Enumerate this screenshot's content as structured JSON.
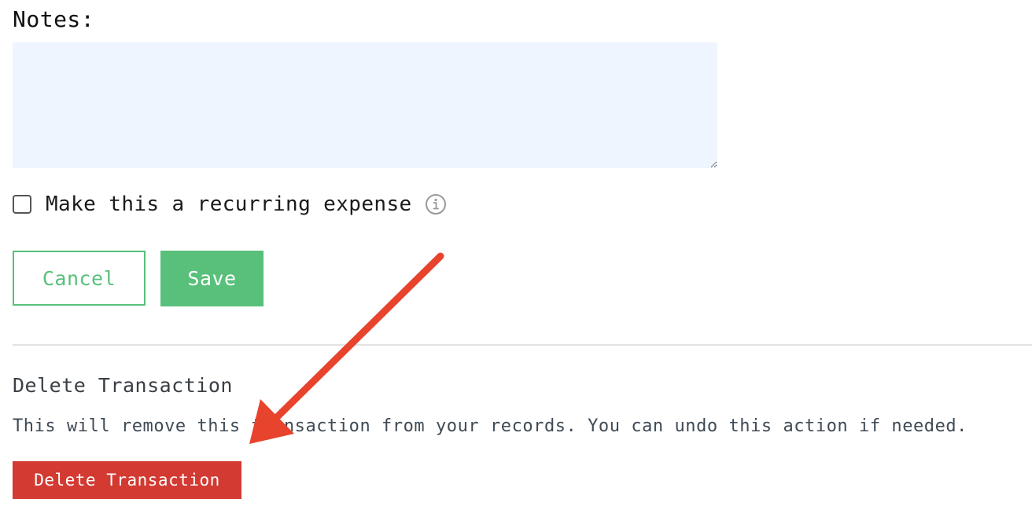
{
  "form": {
    "notes_label": "Notes:",
    "notes_value": "",
    "recurring_label": "Make this a recurring expense",
    "recurring_checked": false,
    "info_icon": "info-icon",
    "cancel_label": "Cancel",
    "save_label": "Save"
  },
  "delete_section": {
    "heading": "Delete Transaction",
    "description": "This will remove this transaction from your records. You can undo this action if needed.",
    "button_label": "Delete Transaction"
  },
  "annotation": {
    "type": "arrow",
    "color": "#e8432d"
  },
  "colors": {
    "accent_green": "#58c07a",
    "danger_red": "#d23a32",
    "textarea_bg": "#eff5ff"
  }
}
